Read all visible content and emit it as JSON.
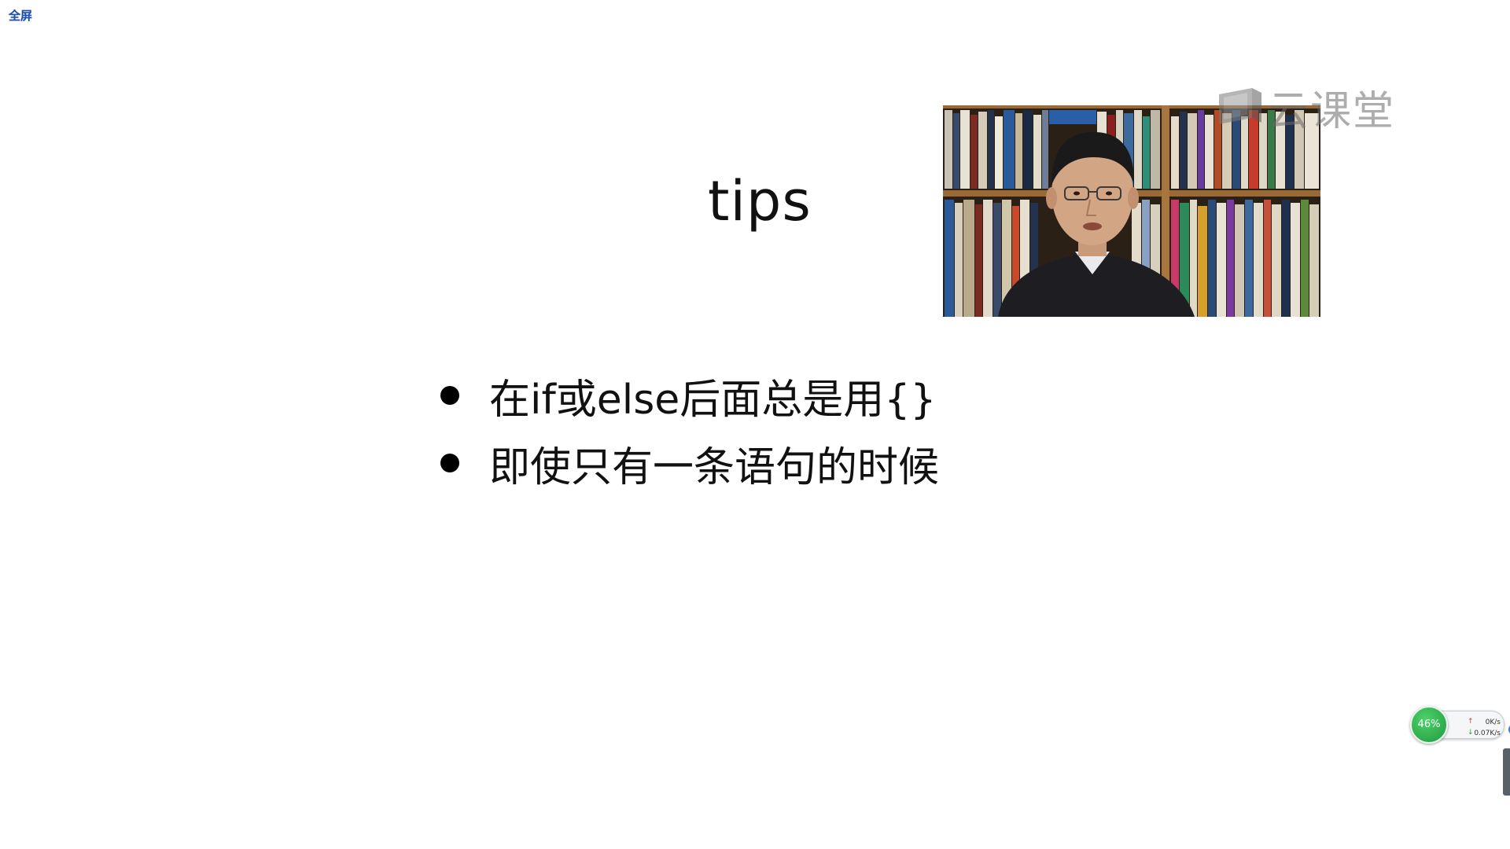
{
  "toolbar": {
    "fullscreen_label": "全屏"
  },
  "slide": {
    "title": "tips",
    "bullets": [
      "在if或else后面总是用{}",
      "即使只有一条语句的时候"
    ]
  },
  "watermark": {
    "text": "云课堂",
    "icon": "cloud-classroom-logo"
  },
  "net_monitor": {
    "percent": "46%",
    "upload": "0K/s",
    "download": "0.07K/s",
    "colors": {
      "circle": "#1e9a3c",
      "upload_arrow": "#d23a2a",
      "download_arrow": "#2a9a3a"
    }
  },
  "colors": {
    "background": "#ffffff",
    "text": "#111111",
    "fullscreen_label": "#1f4fa8"
  }
}
